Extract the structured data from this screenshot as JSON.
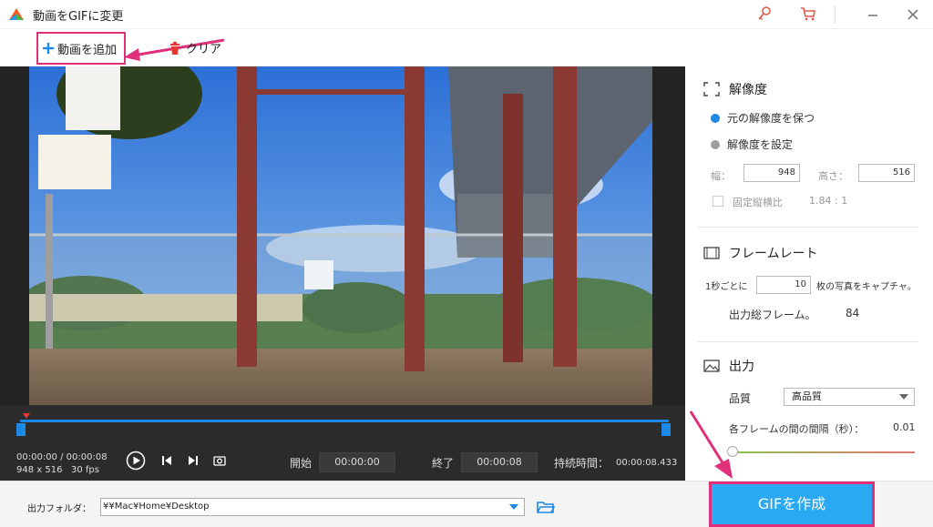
{
  "window": {
    "title": "動画をGIFに変更"
  },
  "toolbar": {
    "add_video_label": "動画を追加",
    "clear_label": "クリア"
  },
  "player": {
    "current_time": "00:00:00",
    "total_time": "00:00:08",
    "time_separator": "/",
    "resolution": "948 x 516",
    "fps": "30 fps",
    "start_label": "開始",
    "start_value": "00:00:00",
    "end_label": "終了",
    "end_value": "00:00:08",
    "duration_label": "持続時間：",
    "duration_value": "00:00:08.433"
  },
  "resolution_section": {
    "title": "解像度",
    "keep_original_label": "元の解像度を保つ",
    "set_resolution_label": "解像度を設定",
    "width_label": "幅：",
    "width_value": "948",
    "height_label": "高さ：",
    "height_value": "516",
    "aspect_label": "固定縦横比",
    "aspect_value": "1.84 : 1"
  },
  "framerate_section": {
    "title": "フレームレート",
    "per_second_label": "1秒ごとに",
    "per_second_value": "10",
    "capture_suffix": "枚の写真をキャプチャ。",
    "total_frames_label": "出力総フレーム。",
    "total_frames_value": "84"
  },
  "output_section": {
    "title": "出力",
    "quality_label": "品質",
    "quality_value": "高品質",
    "interval_label": "各フレームの間の間隔（秒）：",
    "interval_value": "0.01"
  },
  "bottom": {
    "output_folder_label": "出力フォルダ：",
    "output_path": "¥¥Mac¥Home¥Desktop",
    "make_gif_label": "GIFを作成"
  },
  "colors": {
    "accent": "#2aa8f2",
    "highlight": "#e0307a",
    "timeline": "#1e88e5"
  }
}
